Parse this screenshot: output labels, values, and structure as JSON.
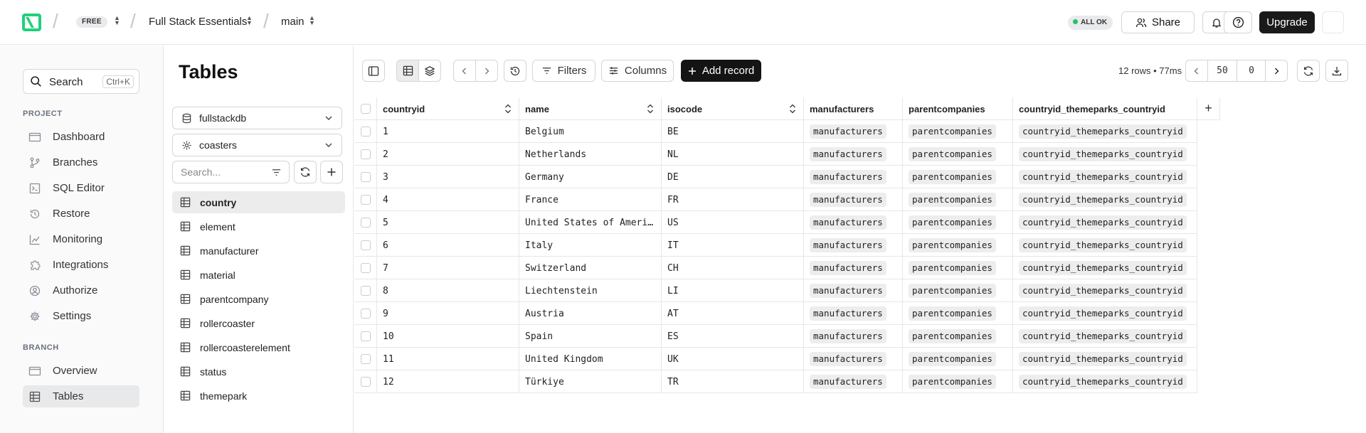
{
  "topbar": {
    "plan_badge": "FREE",
    "project_name": "Full Stack Essentials",
    "branch_name": "main",
    "status": "ALL OK",
    "share_label": "Share",
    "upgrade_label": "Upgrade"
  },
  "sidebar": {
    "search_label": "Search",
    "search_shortcut": "Ctrl+K",
    "project_section": "PROJECT",
    "project_items": [
      {
        "label": "Dashboard",
        "icon": "dashboard-icon"
      },
      {
        "label": "Branches",
        "icon": "branch-icon"
      },
      {
        "label": "SQL Editor",
        "icon": "terminal-icon"
      },
      {
        "label": "Restore",
        "icon": "restore-icon"
      },
      {
        "label": "Monitoring",
        "icon": "chart-icon"
      },
      {
        "label": "Integrations",
        "icon": "puzzle-icon"
      },
      {
        "label": "Authorize",
        "icon": "user-circle-icon"
      },
      {
        "label": "Settings",
        "icon": "gear-icon"
      }
    ],
    "branch_section": "BRANCH",
    "branch_items": [
      {
        "label": "Overview",
        "icon": "overview-icon"
      },
      {
        "label": "Tables",
        "icon": "table-icon",
        "active": true
      }
    ]
  },
  "tables_pane": {
    "title": "Tables",
    "database": "fullstackdb",
    "schema": "coasters",
    "search_placeholder": "Search...",
    "tables": [
      "country",
      "element",
      "manufacturer",
      "material",
      "parentcompany",
      "rollercoaster",
      "rollercoasterelement",
      "status",
      "themepark"
    ],
    "active_table": "country"
  },
  "toolbar": {
    "filters_label": "Filters",
    "columns_label": "Columns",
    "add_record_label": "Add record",
    "row_info": "12 rows • 77ms",
    "page_size": "50",
    "offset": "0"
  },
  "grid": {
    "columns": [
      "countryid",
      "name",
      "isocode",
      "manufacturers",
      "parentcompanies",
      "countryid_themeparks_countryid"
    ],
    "rows": [
      {
        "countryid": "1",
        "name": "Belgium",
        "isocode": "BE"
      },
      {
        "countryid": "2",
        "name": "Netherlands",
        "isocode": "NL"
      },
      {
        "countryid": "3",
        "name": "Germany",
        "isocode": "DE"
      },
      {
        "countryid": "4",
        "name": "France",
        "isocode": "FR"
      },
      {
        "countryid": "5",
        "name": "United States of America",
        "isocode": "US"
      },
      {
        "countryid": "6",
        "name": "Italy",
        "isocode": "IT"
      },
      {
        "countryid": "7",
        "name": "Switzerland",
        "isocode": "CH"
      },
      {
        "countryid": "8",
        "name": "Liechtenstein",
        "isocode": "LI"
      },
      {
        "countryid": "9",
        "name": "Austria",
        "isocode": "AT"
      },
      {
        "countryid": "10",
        "name": "Spain",
        "isocode": "ES"
      },
      {
        "countryid": "11",
        "name": "United Kingdom",
        "isocode": "UK"
      },
      {
        "countryid": "12",
        "name": "Türkiye",
        "isocode": "TR"
      }
    ],
    "relation_pills": [
      "manufacturers",
      "parentcompanies",
      "countryid_themeparks_countryid"
    ]
  },
  "colors": {
    "brand": "#21d07b",
    "status_ok": "#21c26b",
    "primary_button": "#141414"
  }
}
